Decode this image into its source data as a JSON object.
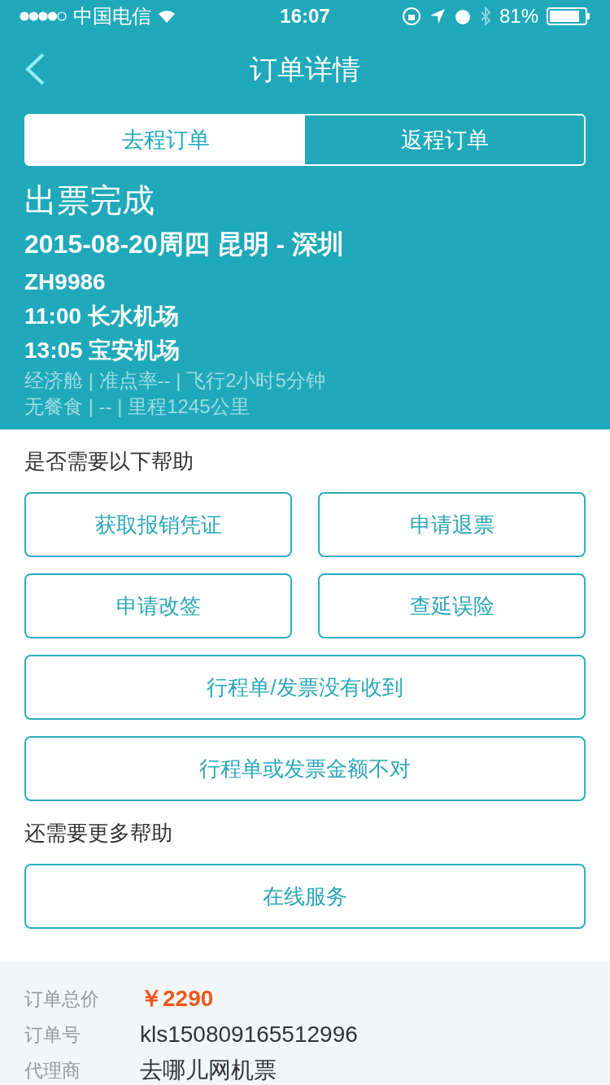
{
  "status_bar": {
    "carrier": "中国电信",
    "time": "16:07",
    "battery": "81%"
  },
  "nav": {
    "title": "订单详情"
  },
  "tabs": [
    {
      "label": "去程订单",
      "selected": true
    },
    {
      "label": "返程订单",
      "selected": false
    }
  ],
  "flight": {
    "status": "出票完成",
    "route": "2015-08-20周四 昆明 - 深圳",
    "flight_no": "ZH9986",
    "departure": "11:00 长水机场",
    "arrival": "13:05 宝安机场",
    "details": [
      "经济舱 | 准点率-- | 飞行2小时5分钟",
      "无餐食 | -- | 里程1245公里"
    ]
  },
  "help": {
    "title": "是否需要以下帮助",
    "buttons": [
      {
        "label": "获取报销凭证",
        "kind": "half"
      },
      {
        "label": "申请退票",
        "kind": "half"
      },
      {
        "label": "申请改签",
        "kind": "half"
      },
      {
        "label": "查延误险",
        "kind": "half"
      },
      {
        "label": "行程单/发票没有收到",
        "kind": "full"
      },
      {
        "label": "行程单或发票金额不对",
        "kind": "full"
      }
    ]
  },
  "more_help": {
    "title": "还需要更多帮助",
    "buttons": [
      {
        "label": "在线服务",
        "kind": "full"
      }
    ]
  },
  "order_info": [
    {
      "label": "订单总价",
      "value": "￥2290",
      "kind": "price"
    },
    {
      "label": "订单号",
      "value": "kls150809165512996",
      "kind": "plain"
    },
    {
      "label": "代理商",
      "value": "去哪儿网机票",
      "kind": "plain"
    }
  ]
}
